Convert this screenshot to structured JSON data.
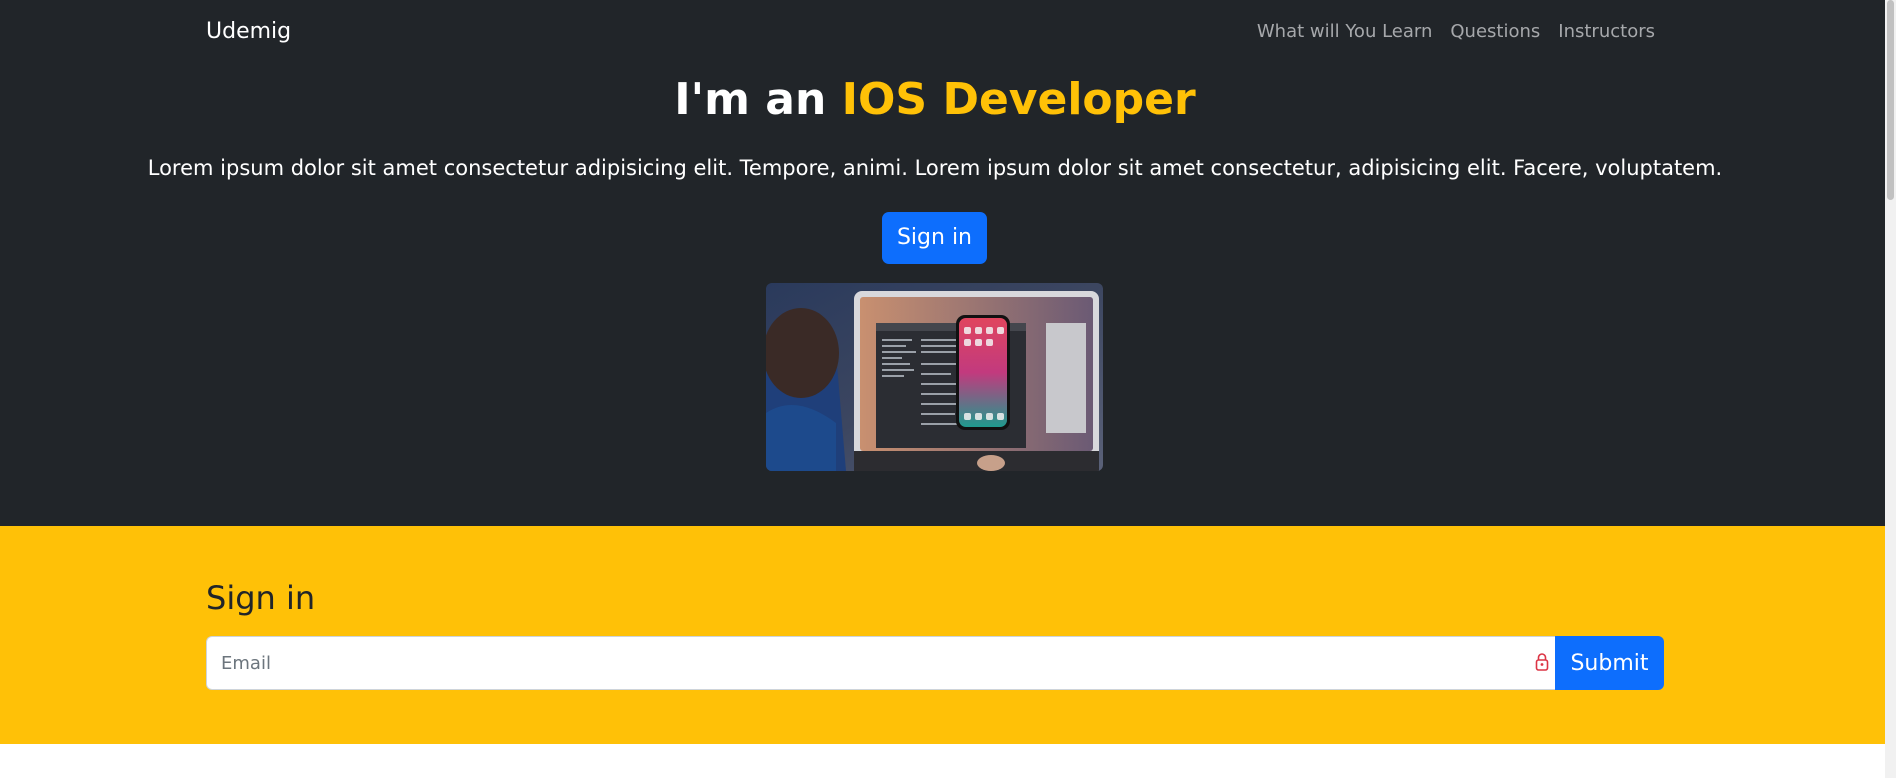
{
  "navbar": {
    "brand": "Udemig",
    "links": [
      "What will You Learn",
      "Questions",
      "Instructors"
    ]
  },
  "hero": {
    "title_prefix": "I'm an",
    "title_accent": "IOS Developer",
    "lead": "Lorem ipsum dolor sit amet consectetur adipisicing elit. Tempore, animi. Lorem ipsum dolor sit amet consectetur, adipisicing elit. Facere, voluptatem.",
    "button_label": "Sign in",
    "image_icon": "laptop-with-iphone-photo"
  },
  "signin": {
    "heading": "Sign in",
    "email_placeholder": "Email",
    "email_value": "",
    "submit_label": "Submit",
    "input_icon": "lock-icon"
  },
  "colors": {
    "hero_bg": "#212529",
    "accent": "#ffc107",
    "primary": "#0d6efd",
    "nav_link": "#a6a8ab"
  }
}
